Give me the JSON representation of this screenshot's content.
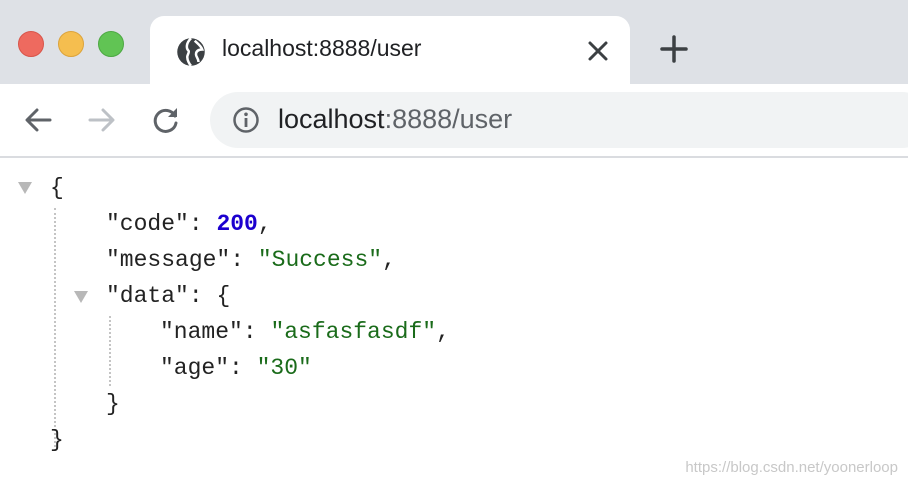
{
  "browser": {
    "tab": {
      "title": "localhost:8888/user",
      "favicon": "globe-icon",
      "close_icon": "close-icon"
    },
    "new_tab_icon": "plus-icon",
    "toolbar": {
      "back_icon": "arrow-left-icon",
      "forward_icon": "arrow-right-icon",
      "reload_icon": "reload-icon",
      "info_icon": "info-icon",
      "url_host": "localhost",
      "url_rest": ":8888/user"
    }
  },
  "json_view": {
    "open_brace": "{",
    "close_brace": "}",
    "code_key": "\"code\"",
    "code_value": "200",
    "message_key": "\"message\"",
    "message_value": "\"Success\"",
    "data_key": "\"data\"",
    "name_key": "\"name\"",
    "name_value": "\"asfasfasdf\"",
    "age_key": "\"age\"",
    "age_value": "\"30\"",
    "colon": ": ",
    "comma": ",",
    "colors": {
      "number": "#1c00cf",
      "string": "#1a6b1a",
      "text": "#222222"
    }
  },
  "watermark": "https://blog.csdn.net/yoonerloop"
}
